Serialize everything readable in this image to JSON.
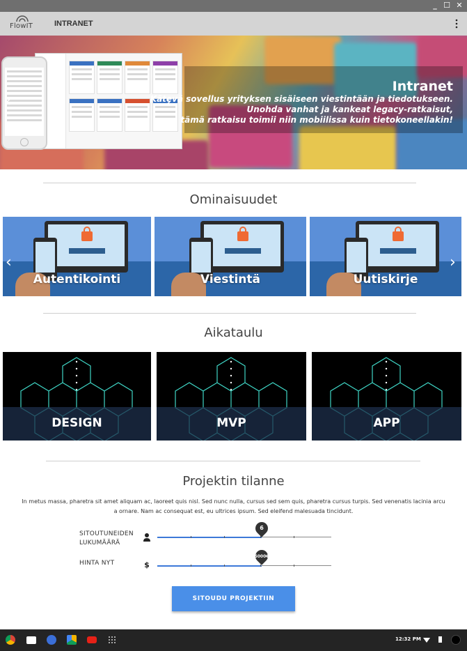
{
  "window": {
    "minimize": "_",
    "maximize": "☐",
    "close": "✕"
  },
  "header": {
    "logo": "FlowIT",
    "title": "INTRANET",
    "menu_icon": "kebab-menu-icon"
  },
  "hero": {
    "title": "Intranet",
    "lines": [
      "Kätevä sovellus yrityksen sisäiseen viestintään ja tiedotukseen.",
      "Unohda vanhat ja kankeat legacy-ratkaisut,",
      "tämä ratkaisu toimii niin mobiilissa kuin tietokoneellakin!"
    ],
    "prev_arrow": "‹",
    "next_arrow": "›"
  },
  "features": {
    "title": "Ominaisuudet",
    "items": [
      {
        "label": "Autentikointi"
      },
      {
        "label": "Viestintä"
      },
      {
        "label": "Uutiskirje"
      }
    ],
    "prev_arrow": "‹",
    "next_arrow": "›"
  },
  "schedule": {
    "title": "Aikataulu",
    "items": [
      {
        "label": "DESIGN"
      },
      {
        "label": "MVP"
      },
      {
        "label": "APP"
      }
    ]
  },
  "status": {
    "title": "Projektin tilanne",
    "description": "In metus massa, pharetra sit amet aliquam ac, laoreet quis nisl. Sed nunc nulla, cursus sed sem quis, pharetra cursus turpis. Sed venenatis lacinia arcu a ornare. Nam ac consequat est, eu ultrices ipsum. Sed eleifend malesuada tincidunt.",
    "sliders": [
      {
        "label_line1": "SITOUTUNEIDEN",
        "label_line2": "LUKUMÄÄRÄ",
        "icon": "person-icon",
        "value_text": "6",
        "fraction": 0.6
      },
      {
        "label_line1": "HINTA NYT",
        "label_line2": "",
        "icon": "dollar-icon",
        "value_text": "5000€",
        "fraction": 0.6
      }
    ],
    "cta": "SITOUDU PROJEKTIIN"
  },
  "taskbar": {
    "apps": [
      "chrome-icon",
      "gmail-icon",
      "google-plus-icon",
      "drive-icon",
      "youtube-icon",
      "app-launcher-icon"
    ],
    "time": "12:32 PM"
  },
  "colors": {
    "accent": "#4a8fe8",
    "feature_bg": "#5b8fd8",
    "schedule_band": "#1e2f4b"
  }
}
